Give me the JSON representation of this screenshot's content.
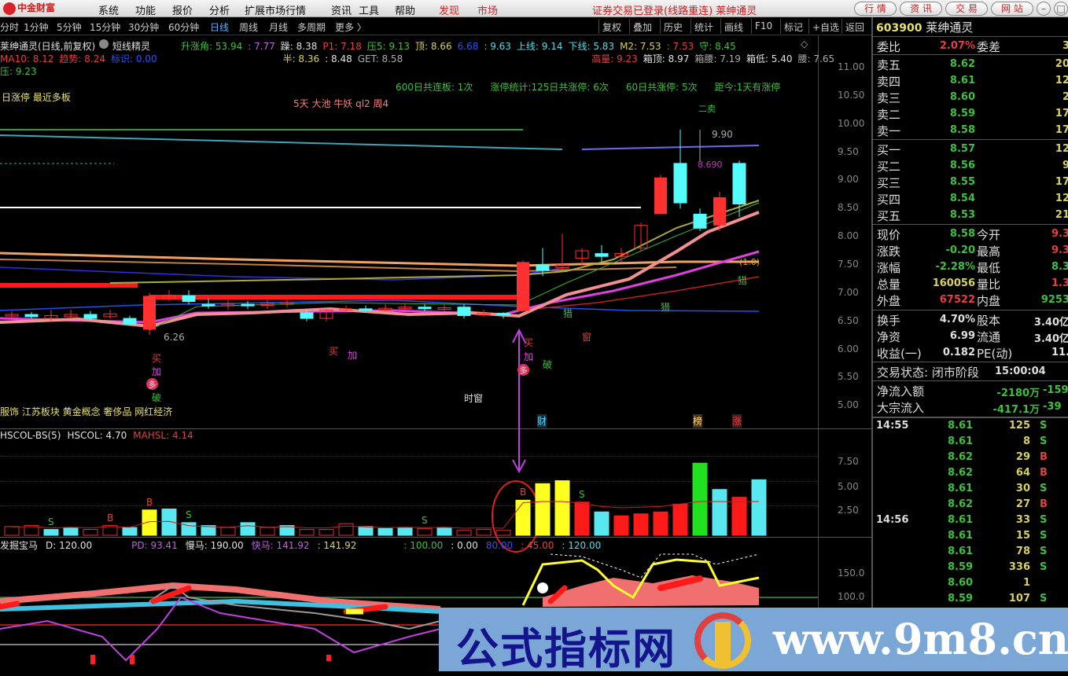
{
  "menubar": {
    "logo": "中金财富",
    "items": [
      "系统",
      "功能",
      "报价",
      "分析",
      "扩展市场行情",
      "资讯",
      "工具",
      "帮助"
    ],
    "highlight": [
      "发现",
      "市场"
    ],
    "status": "证券交易已登录(线路重连)  莱绅通灵",
    "buttons": [
      "行 情",
      "资 讯",
      "交 易",
      "网 站"
    ]
  },
  "periods": [
    "分时",
    "1分钟",
    "5分钟",
    "15分钟",
    "30分钟",
    "60分钟",
    "日线",
    "周线",
    "月线",
    "多周期",
    "更多 〉"
  ],
  "active_period": "日线",
  "toolbar": [
    "复权",
    "叠加",
    "历史",
    "统计",
    "画线",
    "F10",
    "标记",
    "+自选",
    "返回"
  ],
  "stock": {
    "code": "603900",
    "name": "莱绅通灵"
  },
  "main_chart": {
    "title": "莱绅通灵(日线,前复权)",
    "indicator": "短线精灵",
    "line1": [
      {
        "t": "升涨角: 53.94",
        "c": "g"
      },
      {
        "t": ": 7.77",
        "c": "m"
      },
      {
        "t": "躁: 8.38",
        "c": "w"
      },
      {
        "t": "P1: 7.18",
        "c": "r"
      },
      {
        "t": "压5: 9.13",
        "c": "g"
      },
      {
        "t": "顶: 8.66",
        "c": "y"
      },
      {
        "t": "6.68",
        "c": "b"
      },
      {
        "t": ": 9.63",
        "c": "c"
      },
      {
        "t": "上线: 9.14",
        "c": "c"
      },
      {
        "t": "下线: 5.83",
        "c": "c"
      },
      {
        "t": "M2: 7.53",
        "c": "y"
      },
      {
        "t": ": 7.53",
        "c": "r"
      },
      {
        "t": "守: 8.45",
        "c": "g"
      }
    ],
    "line2": [
      {
        "t": "MA10: 8.12",
        "c": "r"
      },
      {
        "t": "趋势: 8.24",
        "c": "r"
      },
      {
        "t": "标识: 0.00",
        "c": "b"
      },
      {
        "t": "半: 8.36",
        "c": "y"
      },
      {
        "t": ": 8.48",
        "c": "w"
      },
      {
        "t": "GET: 8.58",
        "c": "gr"
      },
      {
        "t": "高量: 9.23",
        "c": "r"
      },
      {
        "t": "箱顶: 8.97",
        "c": "w"
      },
      {
        "t": "箱腰: 7.19",
        "c": "gr"
      },
      {
        "t": "箱低: 5.40",
        "c": "w"
      },
      {
        "t": "腰: 7.65",
        "c": "gr"
      }
    ],
    "line3": "压: 9.23",
    "limit_text": "日涨停 最近多板",
    "stats": [
      "600日共连板: 1次",
      "涨停统计:125日共涨停: 6次",
      "60日共涨停: 5次",
      "距今:1天有涨停"
    ],
    "tags": "5天 大池 牛妖 ql2 周4",
    "concepts": "服饰 江苏板块 黄金概念 奢侈品 网红经济",
    "y_ticks": [
      "11.00",
      "10.50",
      "10.00",
      "9.50",
      "9.00",
      "8.50",
      "8.00",
      "7.50",
      "7.00",
      "6.50",
      "6.00",
      "5.50",
      "5.00"
    ],
    "high_label": "9.90",
    "low_label": "6.26",
    "mid_label": "8.690",
    "time_window": "时窗",
    "signals": {
      "buy": "买",
      "add": "加",
      "more": "多",
      "break": "破",
      "window": "窗",
      "wealth": "财",
      "rank": "榜",
      "rise": "涨",
      "trap": "猎",
      "sell": "二卖",
      "target": "(1.0)"
    }
  },
  "chart_data": [
    {
      "type": "candlestick",
      "ylim": [
        5.0,
        11.0
      ],
      "candles_ohlc": [
        [
          6.6,
          6.62,
          6.68,
          6.55
        ],
        [
          6.62,
          6.58,
          6.66,
          6.55
        ],
        [
          6.55,
          6.6,
          6.7,
          6.5
        ],
        [
          6.58,
          6.62,
          6.7,
          6.55
        ],
        [
          6.62,
          6.55,
          6.68,
          6.5
        ],
        [
          6.58,
          6.63,
          6.7,
          6.55
        ],
        [
          6.55,
          6.45,
          6.6,
          6.42
        ],
        [
          6.35,
          6.95,
          7.0,
          6.26
        ],
        [
          6.9,
          6.95,
          7.05,
          6.85
        ],
        [
          6.95,
          6.85,
          7.05,
          6.8
        ],
        [
          6.8,
          6.78,
          6.9,
          6.72
        ],
        [
          6.78,
          6.8,
          6.88,
          6.7
        ],
        [
          6.8,
          6.78,
          6.86,
          6.72
        ],
        [
          6.78,
          6.82,
          6.9,
          6.72
        ],
        [
          6.8,
          6.83,
          6.9,
          6.75
        ],
        [
          6.65,
          6.55,
          6.72,
          6.5
        ],
        [
          6.55,
          6.7,
          6.72,
          6.5
        ],
        [
          6.7,
          6.72,
          6.78,
          6.65
        ],
        [
          6.72,
          6.7,
          6.78,
          6.65
        ],
        [
          6.7,
          6.73,
          6.8,
          6.67
        ],
        [
          6.73,
          6.75,
          6.82,
          6.7
        ],
        [
          6.75,
          6.72,
          6.8,
          6.68
        ],
        [
          6.72,
          6.74,
          6.8,
          6.68
        ],
        [
          6.75,
          6.6,
          6.8,
          6.55
        ],
        [
          6.62,
          6.64,
          6.7,
          6.58
        ],
        [
          6.64,
          6.62,
          6.66,
          6.55
        ],
        [
          6.68,
          7.55,
          7.58,
          6.66
        ],
        [
          7.5,
          7.4,
          7.8,
          7.3
        ],
        [
          7.45,
          7.5,
          8.05,
          7.4
        ],
        [
          7.62,
          7.75,
          7.8,
          7.5
        ],
        [
          7.7,
          7.65,
          7.85,
          7.55
        ],
        [
          7.65,
          7.7,
          7.8,
          7.55
        ],
        [
          7.8,
          8.2,
          8.25,
          7.75
        ],
        [
          8.4,
          9.05,
          9.1,
          8.4
        ],
        [
          9.3,
          8.6,
          9.9,
          8.5
        ],
        [
          8.4,
          8.15,
          8.5,
          8.1
        ],
        [
          8.2,
          8.7,
          8.8,
          8.1
        ],
        [
          9.3,
          8.58,
          9.35,
          8.35
        ]
      ]
    },
    {
      "type": "bar",
      "title": "HSCOL-BS(5)",
      "ylim": [
        0,
        8.5
      ],
      "y_ticks": [
        "7.50",
        "5.00",
        "2.50"
      ],
      "values": [
        0.9,
        1.0,
        0.6,
        0.8,
        0.6,
        1.0,
        0.8,
        2.6,
        2.7,
        1.3,
        1.0,
        0.8,
        1.3,
        0.8,
        1.0,
        0.6,
        0.6,
        1.2,
        0.9,
        0.7,
        0.8,
        0.7,
        0.8,
        0.5,
        0.6,
        0.5,
        3.6,
        5.3,
        5.6,
        3.4,
        2.4,
        2.0,
        2.2,
        2.4,
        3.2,
        7.4,
        4.7,
        3.9,
        5.7
      ],
      "colors": [
        "#e03030",
        "#e03030",
        "#5ae8f0",
        "#5ae8f0",
        "#e03030",
        "#e03030",
        "#5ae8f0",
        "#ffff20",
        "#5ae8f0",
        "#5ae8f0",
        "#5ae8f0",
        "#e03030",
        "#5ae8f0",
        "#e03030",
        "#5ae8f0",
        "#e03030",
        "#e03030",
        "#e03030",
        "#5ae8f0",
        "#5ae8f0",
        "#5ae8f0",
        "#e03030",
        "#5ae8f0",
        "#e03030",
        "#e03030",
        "#e03030",
        "#ffff20",
        "#ffff20",
        "#ffff20",
        "#ff1a1a",
        "#5ae8f0",
        "#ff1a1a",
        "#ff1a1a",
        "#ff1a1a",
        "#ff1a1a",
        "#20e020",
        "#5ae8f0",
        "#ff1a1a",
        "#5ae8f0"
      ],
      "hollow": [
        true,
        true,
        false,
        false,
        true,
        true,
        false,
        false,
        false,
        false,
        false,
        true,
        false,
        true,
        false,
        true,
        true,
        true,
        false,
        false,
        false,
        true,
        false,
        true,
        true,
        true,
        false,
        false,
        false,
        false,
        false,
        false,
        false,
        false,
        false,
        false,
        false,
        false,
        false
      ],
      "markers": [
        {
          "i": 2,
          "t": "S"
        },
        {
          "i": 5,
          "t": "B"
        },
        {
          "i": 7,
          "t": "B"
        },
        {
          "i": 9,
          "t": "S"
        },
        {
          "i": 21,
          "t": "S"
        },
        {
          "i": 26,
          "t": "B"
        },
        {
          "i": 29,
          "t": "S"
        }
      ]
    }
  ],
  "volume_panel": {
    "header": [
      {
        "t": "HSCOL-BS(5)",
        "c": "w"
      },
      {
        "t": "HSCOL: 4.70",
        "c": "w"
      },
      {
        "t": "MAHSL: 4.14",
        "c": "r"
      }
    ]
  },
  "bottom_panel": {
    "header": [
      {
        "t": "发掘宝马",
        "c": "w"
      },
      {
        "t": "D: 120.00",
        "c": "w"
      },
      {
        "t": "PD: 93.41",
        "c": "m"
      },
      {
        "t": "慢马: 190.00",
        "c": "w"
      },
      {
        "t": "快马: 141.92",
        "c": "m"
      },
      {
        "t": ": 141.92",
        "c": "y"
      },
      {
        "t": ": 100.00",
        "c": "g"
      },
      {
        "t": ": 0.00",
        "c": "w"
      },
      {
        "t": "80.00",
        "c": "b"
      },
      {
        "t": ": 45.00",
        "c": "r"
      },
      {
        "t": ": 120.00",
        "c": "c"
      }
    ],
    "y_ticks": [
      "150.0",
      "100.0"
    ]
  },
  "quote": {
    "weibi": {
      "label": "委比",
      "value": "2.07%",
      "label2": "委差",
      "value2": "3"
    },
    "asks": [
      {
        "label": "卖五",
        "price": "8.62",
        "vol": "20"
      },
      {
        "label": "卖四",
        "price": "8.61",
        "vol": "12"
      },
      {
        "label": "卖三",
        "price": "8.60",
        "vol": "2"
      },
      {
        "label": "卖二",
        "price": "8.59",
        "vol": "17"
      },
      {
        "label": "卖一",
        "price": "8.58",
        "vol": "17"
      }
    ],
    "bids": [
      {
        "label": "买一",
        "price": "8.57",
        "vol": "12"
      },
      {
        "label": "买二",
        "price": "8.56",
        "vol": "9"
      },
      {
        "label": "买三",
        "price": "8.55",
        "vol": "17"
      },
      {
        "label": "买四",
        "price": "8.54",
        "vol": "12"
      },
      {
        "label": "买五",
        "price": "8.53",
        "vol": "21"
      }
    ],
    "stats1": [
      {
        "l": "现价",
        "v": "8.58",
        "vc": "g",
        "l2": "今开",
        "v2": "9.3",
        "v2c": "r"
      },
      {
        "l": "涨跌",
        "v": "-0.20",
        "vc": "g",
        "l2": "最高",
        "v2": "9.3",
        "v2c": "r"
      },
      {
        "l": "涨幅",
        "v": "-2.28%",
        "vc": "g",
        "l2": "最低",
        "v2": "8.3",
        "v2c": "g"
      },
      {
        "l": "总量",
        "v": "160056",
        "vc": "y",
        "l2": "量比",
        "v2": "1.3",
        "v2c": "r"
      },
      {
        "l": "外盘",
        "v": "67522",
        "vc": "r",
        "l2": "内盘",
        "v2": "9253",
        "v2c": "g"
      }
    ],
    "stats2": [
      {
        "l": "换手",
        "v": "4.70%",
        "vc": "w",
        "l2": "股本",
        "v2": "3.40亿",
        "v2c": "w"
      },
      {
        "l": "净资",
        "v": "6.99",
        "vc": "w",
        "l2": "流通",
        "v2": "3.40亿",
        "v2c": "w"
      },
      {
        "l": "收益(一)",
        "v": "0.182",
        "vc": "w",
        "l2": "PE(动)",
        "v2": "11.",
        "v2c": "w"
      }
    ],
    "trade_status": {
      "label": "交易状态: 闭市阶段",
      "time": "15:00:04"
    },
    "flows": [
      {
        "l": "净流入额",
        "v": "-2180万",
        "v2": "-159"
      },
      {
        "l": "大宗流入",
        "v": "-417.1万",
        "v2": "-39"
      }
    ],
    "ticks": [
      {
        "time": "14:55",
        "price": "8.61",
        "vol": "125",
        "bs": "S"
      },
      {
        "time": "",
        "price": "8.61",
        "vol": "8",
        "bs": "S"
      },
      {
        "time": "",
        "price": "8.62",
        "vol": "29",
        "bs": "B"
      },
      {
        "time": "",
        "price": "8.62",
        "vol": "64",
        "bs": "B"
      },
      {
        "time": "",
        "price": "8.61",
        "vol": "30",
        "bs": "S"
      },
      {
        "time": "",
        "price": "8.62",
        "vol": "27",
        "bs": "B"
      },
      {
        "time": "14:56",
        "price": "8.61",
        "vol": "33",
        "bs": "S"
      },
      {
        "time": "",
        "price": "8.61",
        "vol": "15",
        "bs": "S"
      },
      {
        "time": "",
        "price": "8.61",
        "vol": "78",
        "bs": "S"
      },
      {
        "time": "",
        "price": "8.59",
        "vol": "336",
        "bs": "S"
      },
      {
        "time": "",
        "price": "8.60",
        "vol": "1",
        "bs": ""
      },
      {
        "time": "",
        "price": "8.59",
        "vol": "107",
        "bs": "S"
      }
    ]
  },
  "watermark": {
    "cn": "公式指标网",
    "url": "www.9m8.cn"
  }
}
